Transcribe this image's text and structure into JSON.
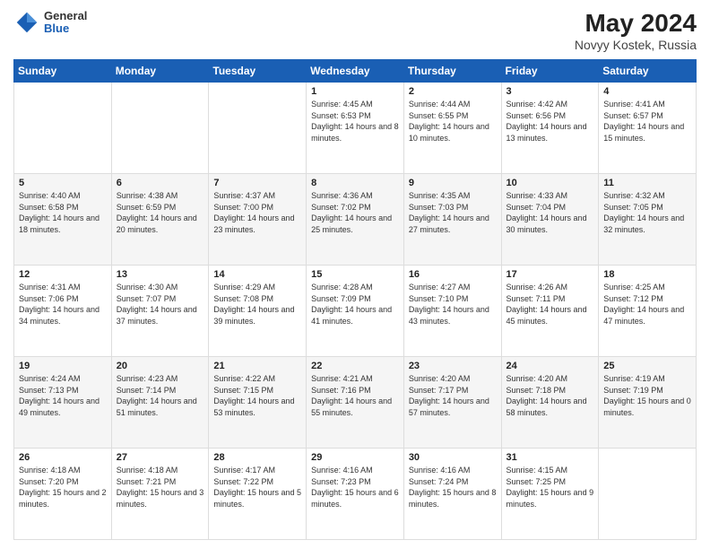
{
  "header": {
    "logo_line1": "General",
    "logo_line2": "Blue",
    "month_year": "May 2024",
    "location": "Novyy Kostek, Russia"
  },
  "days_of_week": [
    "Sunday",
    "Monday",
    "Tuesday",
    "Wednesday",
    "Thursday",
    "Friday",
    "Saturday"
  ],
  "weeks": [
    [
      {
        "day": "",
        "content": ""
      },
      {
        "day": "",
        "content": ""
      },
      {
        "day": "",
        "content": ""
      },
      {
        "day": "1",
        "content": "Sunrise: 4:45 AM\nSunset: 6:53 PM\nDaylight: 14 hours\nand 8 minutes."
      },
      {
        "day": "2",
        "content": "Sunrise: 4:44 AM\nSunset: 6:55 PM\nDaylight: 14 hours\nand 10 minutes."
      },
      {
        "day": "3",
        "content": "Sunrise: 4:42 AM\nSunset: 6:56 PM\nDaylight: 14 hours\nand 13 minutes."
      },
      {
        "day": "4",
        "content": "Sunrise: 4:41 AM\nSunset: 6:57 PM\nDaylight: 14 hours\nand 15 minutes."
      }
    ],
    [
      {
        "day": "5",
        "content": "Sunrise: 4:40 AM\nSunset: 6:58 PM\nDaylight: 14 hours\nand 18 minutes."
      },
      {
        "day": "6",
        "content": "Sunrise: 4:38 AM\nSunset: 6:59 PM\nDaylight: 14 hours\nand 20 minutes."
      },
      {
        "day": "7",
        "content": "Sunrise: 4:37 AM\nSunset: 7:00 PM\nDaylight: 14 hours\nand 23 minutes."
      },
      {
        "day": "8",
        "content": "Sunrise: 4:36 AM\nSunset: 7:02 PM\nDaylight: 14 hours\nand 25 minutes."
      },
      {
        "day": "9",
        "content": "Sunrise: 4:35 AM\nSunset: 7:03 PM\nDaylight: 14 hours\nand 27 minutes."
      },
      {
        "day": "10",
        "content": "Sunrise: 4:33 AM\nSunset: 7:04 PM\nDaylight: 14 hours\nand 30 minutes."
      },
      {
        "day": "11",
        "content": "Sunrise: 4:32 AM\nSunset: 7:05 PM\nDaylight: 14 hours\nand 32 minutes."
      }
    ],
    [
      {
        "day": "12",
        "content": "Sunrise: 4:31 AM\nSunset: 7:06 PM\nDaylight: 14 hours\nand 34 minutes."
      },
      {
        "day": "13",
        "content": "Sunrise: 4:30 AM\nSunset: 7:07 PM\nDaylight: 14 hours\nand 37 minutes."
      },
      {
        "day": "14",
        "content": "Sunrise: 4:29 AM\nSunset: 7:08 PM\nDaylight: 14 hours\nand 39 minutes."
      },
      {
        "day": "15",
        "content": "Sunrise: 4:28 AM\nSunset: 7:09 PM\nDaylight: 14 hours\nand 41 minutes."
      },
      {
        "day": "16",
        "content": "Sunrise: 4:27 AM\nSunset: 7:10 PM\nDaylight: 14 hours\nand 43 minutes."
      },
      {
        "day": "17",
        "content": "Sunrise: 4:26 AM\nSunset: 7:11 PM\nDaylight: 14 hours\nand 45 minutes."
      },
      {
        "day": "18",
        "content": "Sunrise: 4:25 AM\nSunset: 7:12 PM\nDaylight: 14 hours\nand 47 minutes."
      }
    ],
    [
      {
        "day": "19",
        "content": "Sunrise: 4:24 AM\nSunset: 7:13 PM\nDaylight: 14 hours\nand 49 minutes."
      },
      {
        "day": "20",
        "content": "Sunrise: 4:23 AM\nSunset: 7:14 PM\nDaylight: 14 hours\nand 51 minutes."
      },
      {
        "day": "21",
        "content": "Sunrise: 4:22 AM\nSunset: 7:15 PM\nDaylight: 14 hours\nand 53 minutes."
      },
      {
        "day": "22",
        "content": "Sunrise: 4:21 AM\nSunset: 7:16 PM\nDaylight: 14 hours\nand 55 minutes."
      },
      {
        "day": "23",
        "content": "Sunrise: 4:20 AM\nSunset: 7:17 PM\nDaylight: 14 hours\nand 57 minutes."
      },
      {
        "day": "24",
        "content": "Sunrise: 4:20 AM\nSunset: 7:18 PM\nDaylight: 14 hours\nand 58 minutes."
      },
      {
        "day": "25",
        "content": "Sunrise: 4:19 AM\nSunset: 7:19 PM\nDaylight: 15 hours\nand 0 minutes."
      }
    ],
    [
      {
        "day": "26",
        "content": "Sunrise: 4:18 AM\nSunset: 7:20 PM\nDaylight: 15 hours\nand 2 minutes."
      },
      {
        "day": "27",
        "content": "Sunrise: 4:18 AM\nSunset: 7:21 PM\nDaylight: 15 hours\nand 3 minutes."
      },
      {
        "day": "28",
        "content": "Sunrise: 4:17 AM\nSunset: 7:22 PM\nDaylight: 15 hours\nand 5 minutes."
      },
      {
        "day": "29",
        "content": "Sunrise: 4:16 AM\nSunset: 7:23 PM\nDaylight: 15 hours\nand 6 minutes."
      },
      {
        "day": "30",
        "content": "Sunrise: 4:16 AM\nSunset: 7:24 PM\nDaylight: 15 hours\nand 8 minutes."
      },
      {
        "day": "31",
        "content": "Sunrise: 4:15 AM\nSunset: 7:25 PM\nDaylight: 15 hours\nand 9 minutes."
      },
      {
        "day": "",
        "content": ""
      }
    ]
  ]
}
